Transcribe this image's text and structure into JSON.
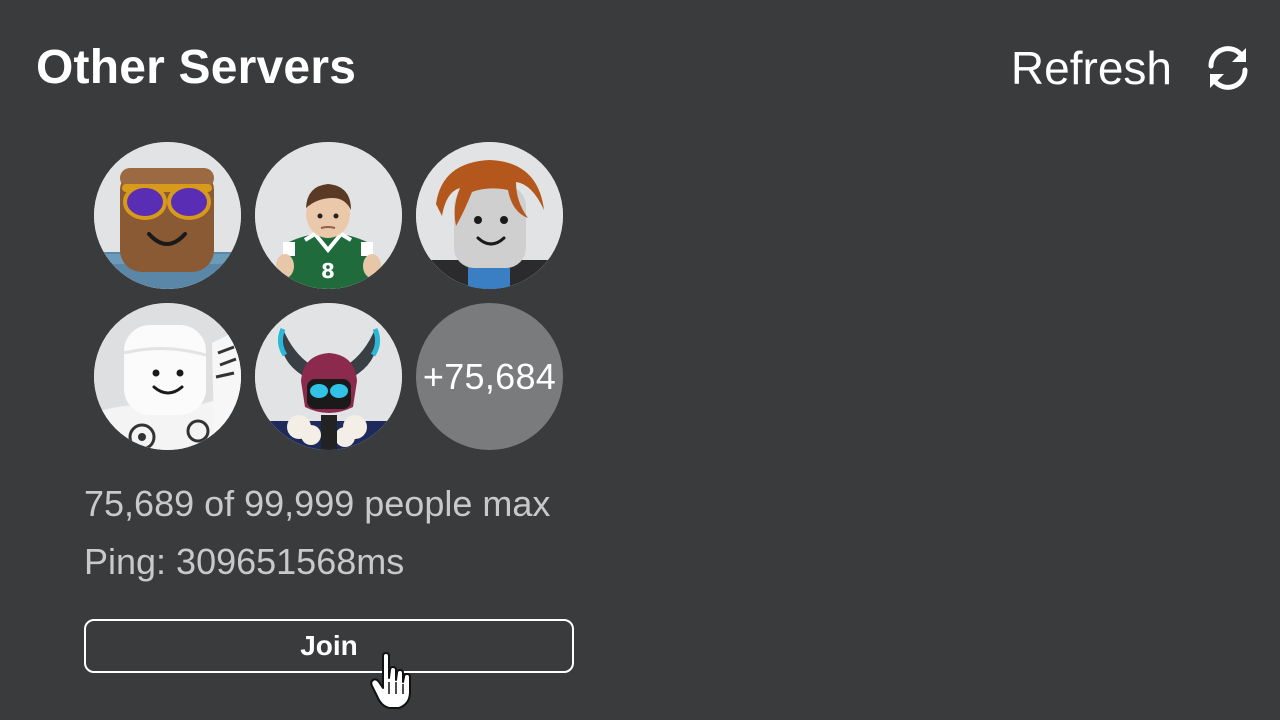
{
  "header": {
    "title": "Other Servers",
    "refresh_label": "Refresh",
    "refresh_icon": "refresh-icon"
  },
  "server": {
    "avatars": [
      {
        "name": "avatar-sunglasses"
      },
      {
        "name": "avatar-green-jersey"
      },
      {
        "name": "avatar-orange-hair"
      },
      {
        "name": "avatar-marshmallow"
      },
      {
        "name": "avatar-horned-helmet"
      }
    ],
    "more_players_label": "+75,684",
    "players_text": "75,689 of 99,999 people max",
    "ping_text": "Ping: 309651568ms",
    "join_label": "Join"
  },
  "colors": {
    "background": "#393b3d",
    "text_primary": "#ffffff",
    "text_secondary": "#c8c9cb",
    "more_badge": "#7a7b7d"
  }
}
